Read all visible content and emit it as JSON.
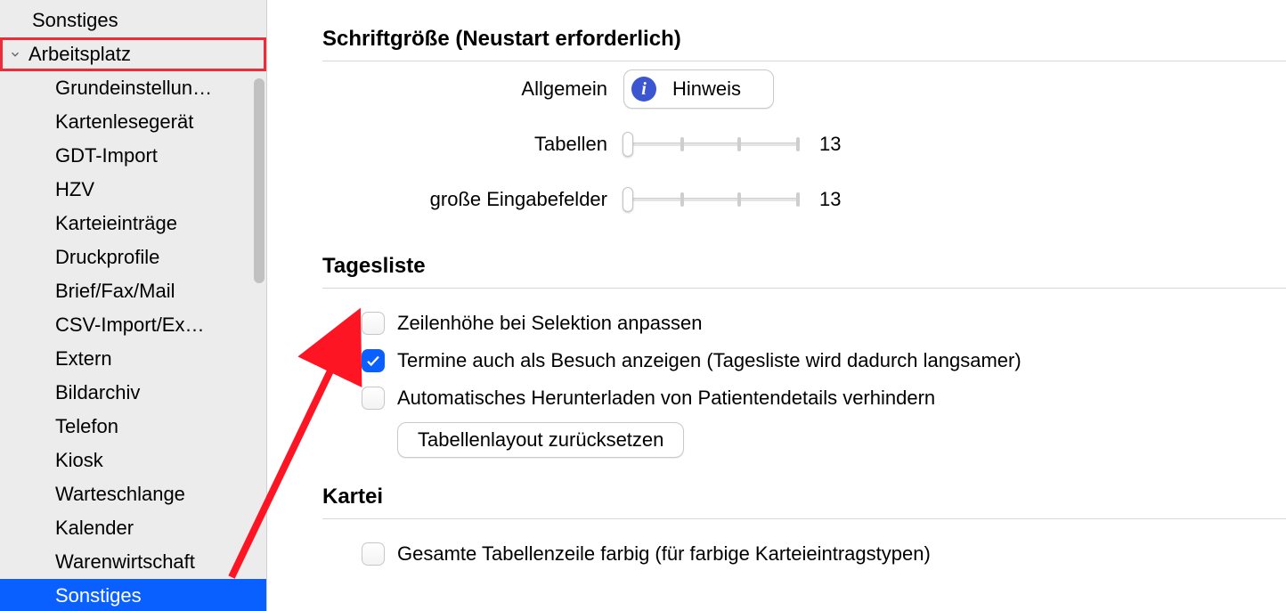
{
  "sidebar": {
    "items": [
      {
        "label": "Sonstiges",
        "level": 1,
        "expandable": false,
        "selected": false,
        "highlighted": false
      },
      {
        "label": "Arbeitsplatz",
        "level": 0,
        "expandable": true,
        "selected": false,
        "highlighted": true
      },
      {
        "label": "Grundeinstellun…",
        "level": 2,
        "expandable": false,
        "selected": false,
        "highlighted": false
      },
      {
        "label": "Kartenlesegerät",
        "level": 2,
        "expandable": false,
        "selected": false,
        "highlighted": false
      },
      {
        "label": "GDT-Import",
        "level": 2,
        "expandable": false,
        "selected": false,
        "highlighted": false
      },
      {
        "label": "HZV",
        "level": 2,
        "expandable": false,
        "selected": false,
        "highlighted": false
      },
      {
        "label": "Karteieinträge",
        "level": 2,
        "expandable": false,
        "selected": false,
        "highlighted": false
      },
      {
        "label": "Druckprofile",
        "level": 2,
        "expandable": false,
        "selected": false,
        "highlighted": false
      },
      {
        "label": "Brief/Fax/Mail",
        "level": 2,
        "expandable": false,
        "selected": false,
        "highlighted": false
      },
      {
        "label": "CSV-Import/Ex…",
        "level": 2,
        "expandable": false,
        "selected": false,
        "highlighted": false
      },
      {
        "label": "Extern",
        "level": 2,
        "expandable": false,
        "selected": false,
        "highlighted": false
      },
      {
        "label": "Bildarchiv",
        "level": 2,
        "expandable": false,
        "selected": false,
        "highlighted": false
      },
      {
        "label": "Telefon",
        "level": 2,
        "expandable": false,
        "selected": false,
        "highlighted": false
      },
      {
        "label": "Kiosk",
        "level": 2,
        "expandable": false,
        "selected": false,
        "highlighted": false
      },
      {
        "label": "Warteschlange",
        "level": 2,
        "expandable": false,
        "selected": false,
        "highlighted": false
      },
      {
        "label": "Kalender",
        "level": 2,
        "expandable": false,
        "selected": false,
        "highlighted": false
      },
      {
        "label": "Warenwirtschaft",
        "level": 2,
        "expandable": false,
        "selected": false,
        "highlighted": false
      },
      {
        "label": "Sonstiges",
        "level": 2,
        "expandable": false,
        "selected": true,
        "highlighted": false
      }
    ]
  },
  "sections": {
    "fontsize": {
      "heading": "Schriftgröße (Neustart erforderlich)"
    },
    "tagesliste": {
      "heading": "Tagesliste"
    },
    "kartei": {
      "heading": "Kartei"
    }
  },
  "fontsize": {
    "row_allgemein_label": "Allgemein",
    "hint_button_label": "Hinweis",
    "row_tabellen_label": "Tabellen",
    "tabellen_value": "13",
    "row_eingabe_label": "große Eingabefelder",
    "eingabe_value": "13"
  },
  "tagesliste": {
    "check1_label": "Zeilenhöhe bei Selektion anpassen",
    "check1_checked": false,
    "check2_label": "Termine auch als Besuch anzeigen (Tagesliste wird dadurch langsamer)",
    "check2_checked": true,
    "check3_label": "Automatisches Herunterladen von Patientendetails verhindern",
    "check3_checked": false,
    "reset_button_label": "Tabellenlayout zurücksetzen"
  },
  "kartei": {
    "check1_label": "Gesamte Tabellenzeile farbig (für farbige Karteieintragstypen)",
    "check1_checked": false
  },
  "colors": {
    "selection": "#0a60ff",
    "highlight_border": "#eb2d3a",
    "arrow": "#fe1524"
  }
}
